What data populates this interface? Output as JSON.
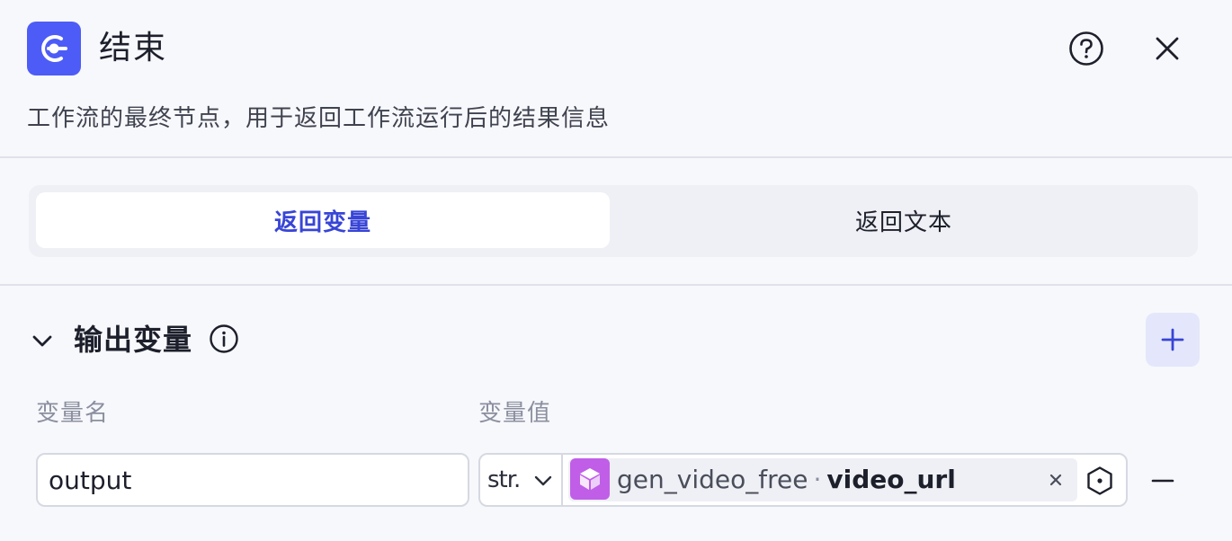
{
  "header": {
    "title": "结束",
    "description": "工作流的最终节点，用于返回工作流运行后的结果信息",
    "icon": "end-node-icon",
    "accent_color": "#4d5cf6"
  },
  "tabs": [
    {
      "label": "返回变量",
      "active": true
    },
    {
      "label": "返回文本",
      "active": false
    }
  ],
  "output_section": {
    "title": "输出变量",
    "columns": {
      "name": "变量名",
      "value": "变量值"
    },
    "rows": [
      {
        "name": "output",
        "type": "str.",
        "ref_node": "gen_video_free",
        "ref_separator": "·",
        "ref_var": "video_url",
        "chip_color": "#c05ee8"
      }
    ]
  }
}
